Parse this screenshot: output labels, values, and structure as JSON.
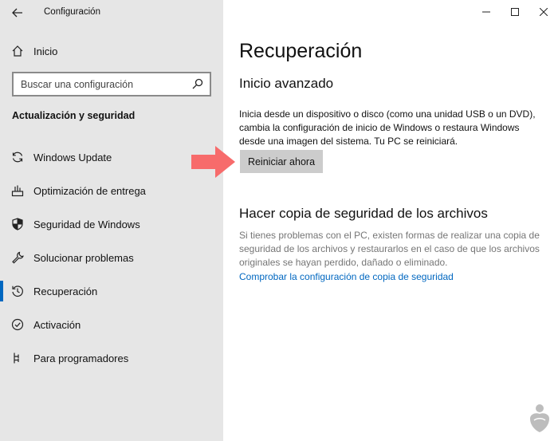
{
  "window": {
    "title": "Configuración",
    "controls": [
      "minimize",
      "maximize",
      "close"
    ]
  },
  "sidebar": {
    "home_label": "Inicio",
    "search_placeholder": "Buscar una configuración",
    "section_title": "Actualización y seguridad",
    "items": [
      {
        "label": "Windows Update",
        "icon": "sync-icon"
      },
      {
        "label": "Optimización de entrega",
        "icon": "delivery-optimization-icon"
      },
      {
        "label": "Seguridad de Windows",
        "icon": "shield-icon"
      },
      {
        "label": "Solucionar problemas",
        "icon": "wrench-icon"
      },
      {
        "label": "Recuperación",
        "icon": "recovery-icon",
        "active": true
      },
      {
        "label": "Activación",
        "icon": "check-circle-icon"
      },
      {
        "label": "Para programadores",
        "icon": "developer-icon"
      }
    ]
  },
  "main": {
    "title": "Recuperación",
    "advanced": {
      "heading": "Inicio avanzado",
      "description": "Inicia desde un dispositivo o disco (como una unidad USB o un DVD), cambia la configuración de inicio de Windows o restaura Windows desde una imagen del sistema. Tu PC se reiniciará.",
      "button_label": "Reiniciar ahora"
    },
    "backup": {
      "heading": "Hacer copia de seguridad de los archivos",
      "description": "Si tienes problemas con el PC, existen formas de realizar una copia de seguridad de los archivos y restaurarlos en el caso de que los archivos originales se hayan perdido, dañado o eliminado.",
      "link_label": "Comprobar la configuración de copia de seguridad"
    }
  },
  "colors": {
    "sidebar_bg": "#e6e6e6",
    "accent": "#0067c0",
    "button_bg": "#cccccc",
    "annotation_arrow": "#f76b6b"
  }
}
